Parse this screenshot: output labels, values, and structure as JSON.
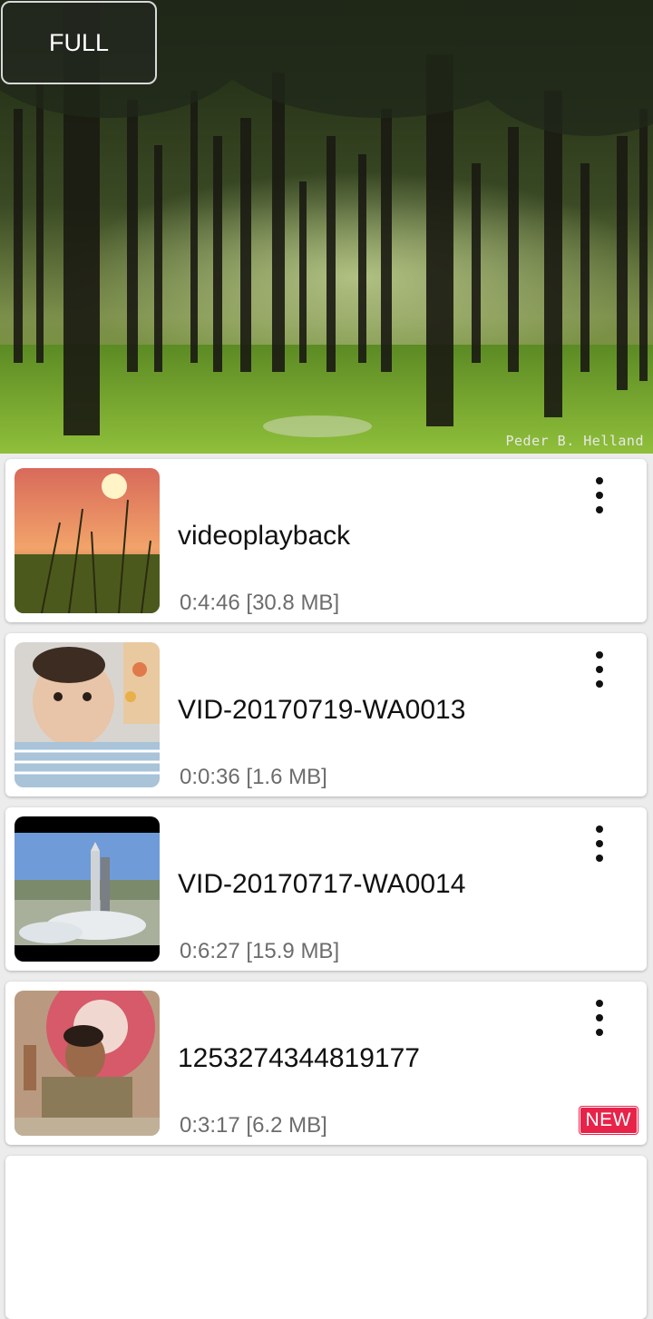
{
  "player": {
    "full_label": "FULL",
    "watermark": "Peder B. Helland"
  },
  "videos": [
    {
      "title": "videoplayback",
      "meta": "0:4:46 [30.8 MB]",
      "is_new": false,
      "thumbnail": "sunset-grass"
    },
    {
      "title": "VID-20170719-WA0013",
      "meta": "0:0:36 [1.6 MB]",
      "is_new": false,
      "thumbnail": "baby"
    },
    {
      "title": "VID-20170717-WA0014",
      "meta": "0:6:27 [15.9 MB]",
      "is_new": false,
      "thumbnail": "rocket-launch"
    },
    {
      "title": "1253274344819177",
      "meta": "0:3:17 [6.2 MB]",
      "is_new": true,
      "badge": "NEW",
      "thumbnail": "speaker"
    }
  ],
  "colors": {
    "badge": "#e8234a",
    "title": "#111111",
    "meta": "#6c6c6c"
  }
}
